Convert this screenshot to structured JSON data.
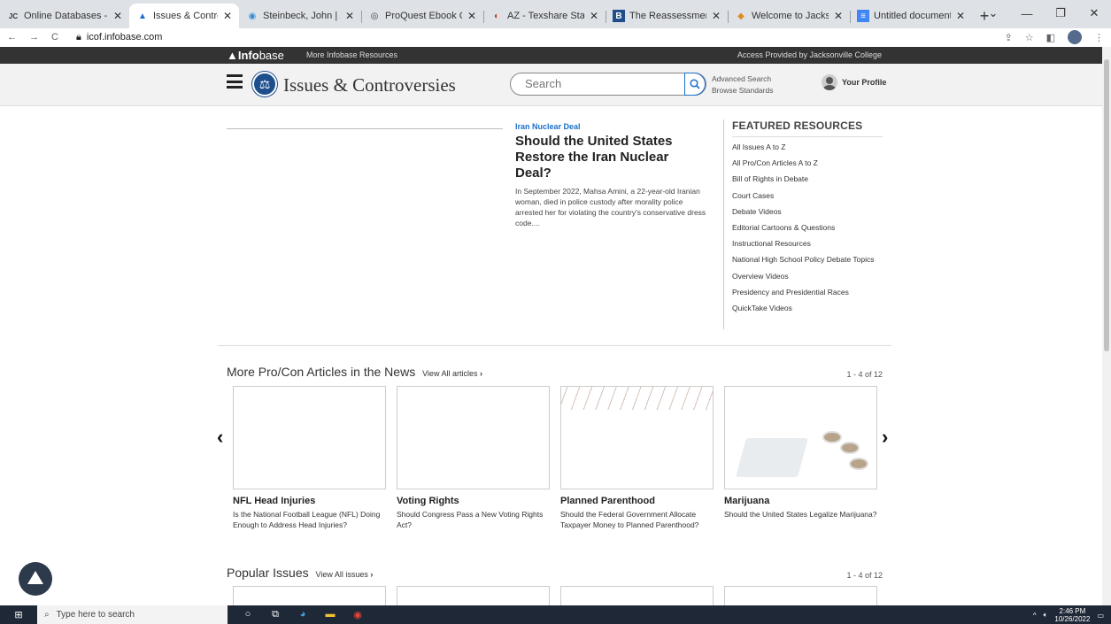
{
  "browser": {
    "tabs": [
      {
        "title": "Online Databases - Jacksonville",
        "icon": "jc-icon",
        "fav": "JC"
      },
      {
        "title": "Issues & Controversies",
        "icon": "infobase-icon",
        "fav": "▲",
        "active": true
      },
      {
        "title": "Steinbeck, John | Article | W",
        "icon": "article-icon",
        "fav": "◉"
      },
      {
        "title": "ProQuest Ebook Central - ",
        "icon": "proquest-icon",
        "fav": "◎"
      },
      {
        "title": "AZ - Texshare State Library",
        "icon": "texshare-icon",
        "fav": "◐"
      },
      {
        "title": "The Reassessment of John",
        "icon": "book-icon",
        "fav": "B"
      },
      {
        "title": "Welcome to Jacksonville C",
        "icon": "college-icon",
        "fav": "◆"
      },
      {
        "title": "Untitled document - Goog",
        "icon": "docs-icon",
        "fav": "≡"
      }
    ],
    "url": "icof.infobase.com"
  },
  "site": {
    "brand_bold": "Info",
    "brand_light": "base",
    "more_resources": "More Infobase Resources",
    "access": "Access Provided by Jacksonville College",
    "title": "Issues & Controversies",
    "search_placeholder": "Search",
    "advanced_search": "Advanced Search",
    "browse_standards": "Browse Standards",
    "profile": "Your Profile"
  },
  "feature": {
    "category": "Iran Nuclear Deal",
    "title": "Should the United States Restore the Iran Nuclear Deal?",
    "description": "In September 2022, Mahsa Amini, a 22-year-old Iranian woman, died in police custody after morality police arrested her for violating the country's conservative dress code...."
  },
  "featured_resources": {
    "heading": "FEATURED RESOURCES",
    "items": [
      "All Issues A to Z",
      "All Pro/Con Articles A to Z",
      "Bill of Rights in Debate",
      "Court Cases",
      "Debate Videos",
      "Editorial Cartoons & Questions",
      "Instructional Resources",
      "National High School Policy Debate Topics",
      "Overview Videos",
      "Presidency and Presidential Races",
      "QuickTake Videos"
    ]
  },
  "procon": {
    "heading": "More Pro/Con Articles in the News",
    "view_all": "View All articles",
    "count": "1 - 4 of 12",
    "cards": [
      {
        "title": "NFL Head Injuries",
        "subtitle": "Is the National Football League (NFL) Doing Enough to Address Head Injuries?"
      },
      {
        "title": "Voting Rights",
        "subtitle": "Should Congress Pass a New Voting Rights Act?"
      },
      {
        "title": "Planned Parenthood",
        "subtitle": "Should the Federal Government Allocate Taxpayer Money to Planned Parenthood?"
      },
      {
        "title": "Marijuana",
        "subtitle": "Should the United States Legalize Marijuana?"
      }
    ]
  },
  "popular": {
    "heading": "Popular Issues",
    "view_all": "View All issues",
    "count": "1 - 4 of 12"
  },
  "taskbar": {
    "search_placeholder": "Type here to search",
    "time": "2:46 PM",
    "date": "10/26/2022"
  }
}
